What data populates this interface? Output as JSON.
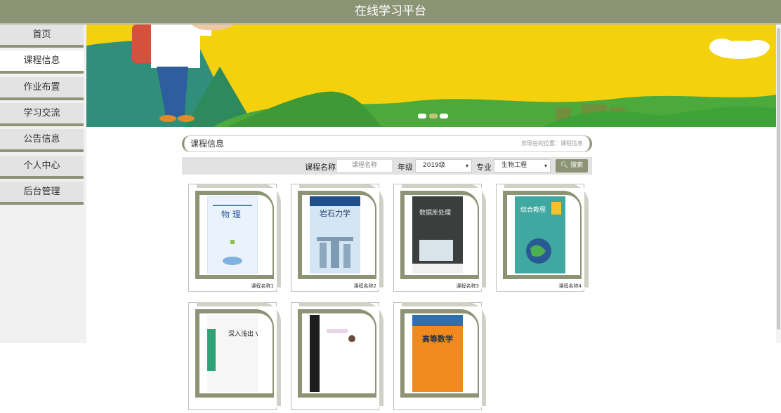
{
  "header": {
    "title": "在线学习平台"
  },
  "sidebar": {
    "items": [
      {
        "label": "首页"
      },
      {
        "label": "课程信息",
        "active": true
      },
      {
        "label": "作业布置"
      },
      {
        "label": "学习交流"
      },
      {
        "label": "公告信息"
      },
      {
        "label": "个人中心"
      },
      {
        "label": "后台管理"
      }
    ]
  },
  "section": {
    "title": "课程信息",
    "location": "您现在的位置：课程信息"
  },
  "search": {
    "name_label": "课程名称",
    "name_placeholder": "课程名称",
    "grade_label": "年级",
    "grade_value": "2019级",
    "major_label": "专业",
    "major_value": "生物工程",
    "button_label": "搜索"
  },
  "courses": [
    {
      "caption": "课程名称1",
      "cover_title": "物 理"
    },
    {
      "caption": "课程名称2",
      "cover_title": "岩石力学"
    },
    {
      "caption": "课程名称3",
      "cover_title": "数据库处理"
    },
    {
      "caption": "课程名称4",
      "cover_title": "综合教程"
    },
    {
      "caption": "",
      "cover_title": "深入浅出 Vue.js"
    },
    {
      "caption": "",
      "cover_title": ""
    },
    {
      "caption": "",
      "cover_title": "高等数学"
    }
  ],
  "colors": {
    "accent": "#8d9476",
    "banner": "#f4d10d"
  }
}
